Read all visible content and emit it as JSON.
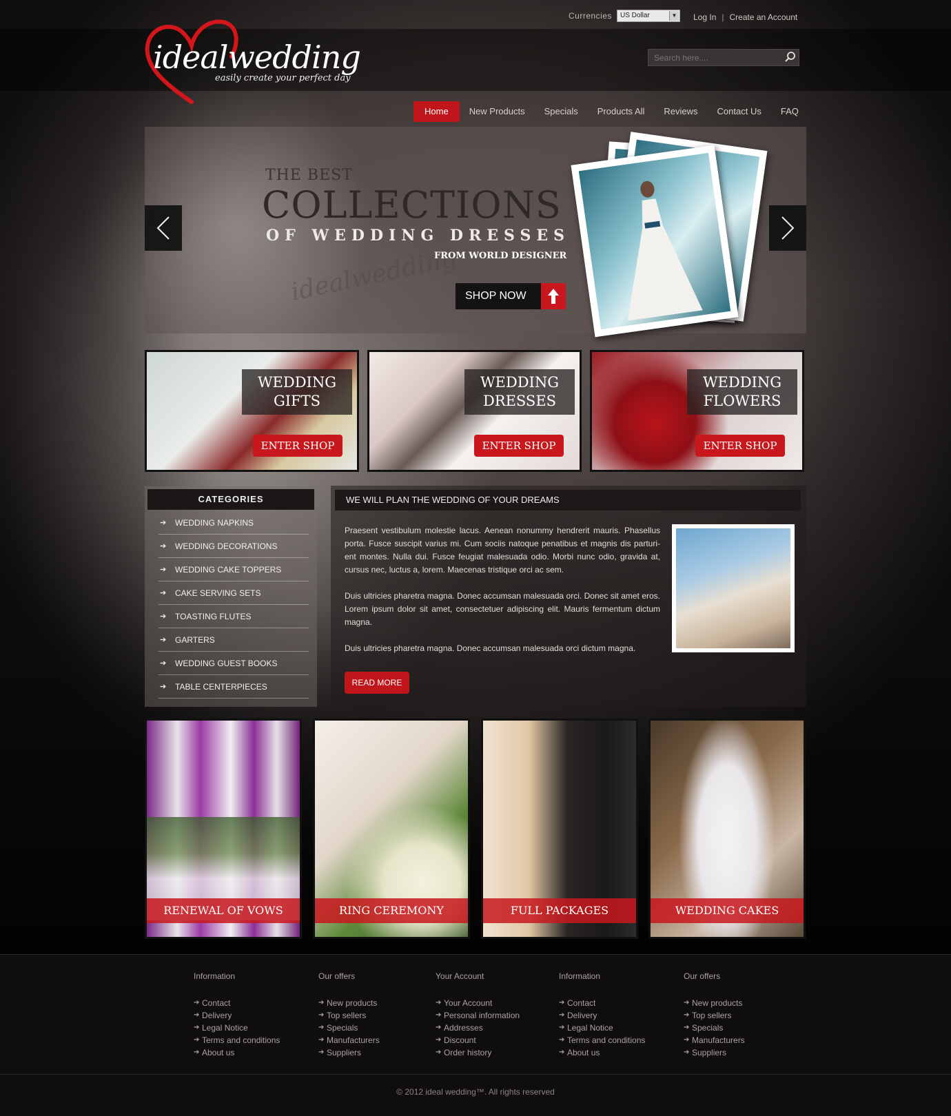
{
  "header": {
    "currencies_label": "Currencies",
    "currency_selected": "US Dollar",
    "login": "Log In",
    "separator": "|",
    "create_account": "Create an Account",
    "logo_text": "idealwedding",
    "logo_tagline": "easily create your perfect day",
    "search_placeholder": "Search here....",
    "accent_color": "#c0161b"
  },
  "nav": {
    "items": [
      "Home",
      "New Products",
      "Specials",
      "Products All",
      "Reviews",
      "Contact Us",
      "FAQ"
    ],
    "active": "Home"
  },
  "slider": {
    "line1": "THE BEST",
    "line2": "COLLECTIONS",
    "line3": "OF WEDDING DRESSES",
    "line4": "FROM WORLD DESIGNER",
    "watermark": "idealwedding",
    "cta": "SHOP NOW",
    "prev_icon": "chevron-left-icon",
    "next_icon": "chevron-right-icon"
  },
  "tiles": [
    {
      "title1": "WEDDING",
      "title2": "GIFTS",
      "cta": "ENTER SHOP"
    },
    {
      "title1": "WEDDING",
      "title2": "DRESSES",
      "cta": "ENTER SHOP"
    },
    {
      "title1": "WEDDING",
      "title2": "FLOWERS",
      "cta": "ENTER SHOP"
    }
  ],
  "categories": {
    "title": "CATEGORIES",
    "items": [
      "WEDDING NAPKINS",
      "WEDDING DECORATIONS",
      "WEDDING CAKE TOPPERS",
      "CAKE SERVING SETS",
      "TOASTING FLUTES",
      "GARTERS",
      "WEDDING GUEST BOOKS",
      "TABLE CENTERPIECES"
    ]
  },
  "about": {
    "title": "WE WILL PLAN THE WEDDING OF YOUR DREAMS",
    "p1": "Praesent vestibulum molestie lacus. Aenean nonummy hendrerit mauris. Phasellus porta. Fusce suscipit varius mi. Cum sociis natoque penatibus et magnis dis parturi-ent montes. Nulla dui. Fusce feugiat malesuada odio. Morbi nunc odio, gravida at, cursus nec, luctus a, lorem. Maecenas tristique orci ac sem.",
    "p2": "Duis ultricies pharetra magna. Donec accumsan malesuada orci. Donec sit amet eros. Lorem ipsum dolor sit amet, consectetuer adipiscing elit. Mauris fermentum dictum magna.",
    "p3": "Duis ultricies pharetra magna. Donec accumsan malesuada orci dictum magna.",
    "read_more": "READ MORE"
  },
  "services": [
    "RENEWAL OF VOWS",
    "RING CEREMONY",
    "FULL PACKAGES",
    "WEDDING CAKES"
  ],
  "footer": {
    "columns": [
      {
        "title": "Information",
        "links": [
          "Contact",
          "Delivery",
          "Legal Notice",
          "Terms and conditions",
          "About us"
        ]
      },
      {
        "title": "Our offers",
        "links": [
          "New products",
          "Top sellers",
          "Specials",
          "Manufacturers",
          "Suppliers"
        ]
      },
      {
        "title": "Your Account",
        "links": [
          "Your Account",
          "Personal information",
          "Addresses",
          "Discount",
          "Order history"
        ]
      },
      {
        "title": "Information",
        "links": [
          "Contact",
          "Delivery",
          "Legal Notice",
          "Terms and conditions",
          "About us"
        ]
      },
      {
        "title": "Our offers",
        "links": [
          "New products",
          "Top sellers",
          "Specials",
          "Manufacturers",
          "Suppliers"
        ]
      }
    ],
    "copyright": "© 2012 ideal wedding™. All rights reserved"
  }
}
